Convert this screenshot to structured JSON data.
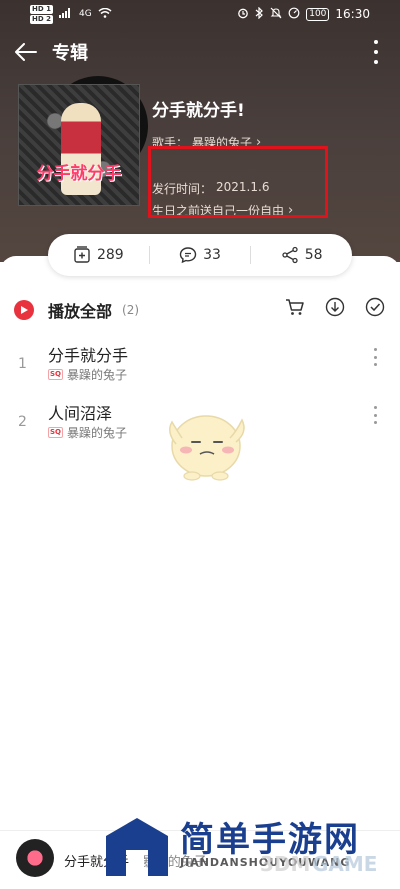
{
  "status_bar": {
    "left_chips": [
      "HD 1",
      "HD 2"
    ],
    "network": "4G",
    "battery": "100",
    "time": "16:30"
  },
  "app_bar": {
    "title": "专辑"
  },
  "album": {
    "cover_text": "分手就分手",
    "title": "分手就分手!",
    "singer_label": "歌手：",
    "singer_name": "暴躁的兔子",
    "release_label": "发行时间：",
    "release_date": "2021.1.6",
    "description": "生日之前送自己一份自由"
  },
  "actions": {
    "collect_count": "289",
    "comment_count": "33",
    "share_count": "58"
  },
  "playlist": {
    "play_all_label": "播放全部",
    "count": "(2)"
  },
  "tracks": [
    {
      "index": "1",
      "title": "分手就分手",
      "badge": "SQ",
      "artist": "暴躁的兔子"
    },
    {
      "index": "2",
      "title": "人间沼泽",
      "badge": "SQ",
      "artist": "暴躁的兔子"
    }
  ],
  "mini_player": {
    "title": "分手就分手",
    "separator": " - ",
    "artist": "暴躁的兔子"
  },
  "watermark": {
    "chinese": "简单手游网",
    "pinyin": "JIANDANSHOUYOUWANG",
    "brand_3dm": "3DM",
    "brand_game": "GAME"
  },
  "colors": {
    "accent": "#e8323e",
    "hero_bg": "#3b3230",
    "highlight_box": "#e0131d"
  }
}
